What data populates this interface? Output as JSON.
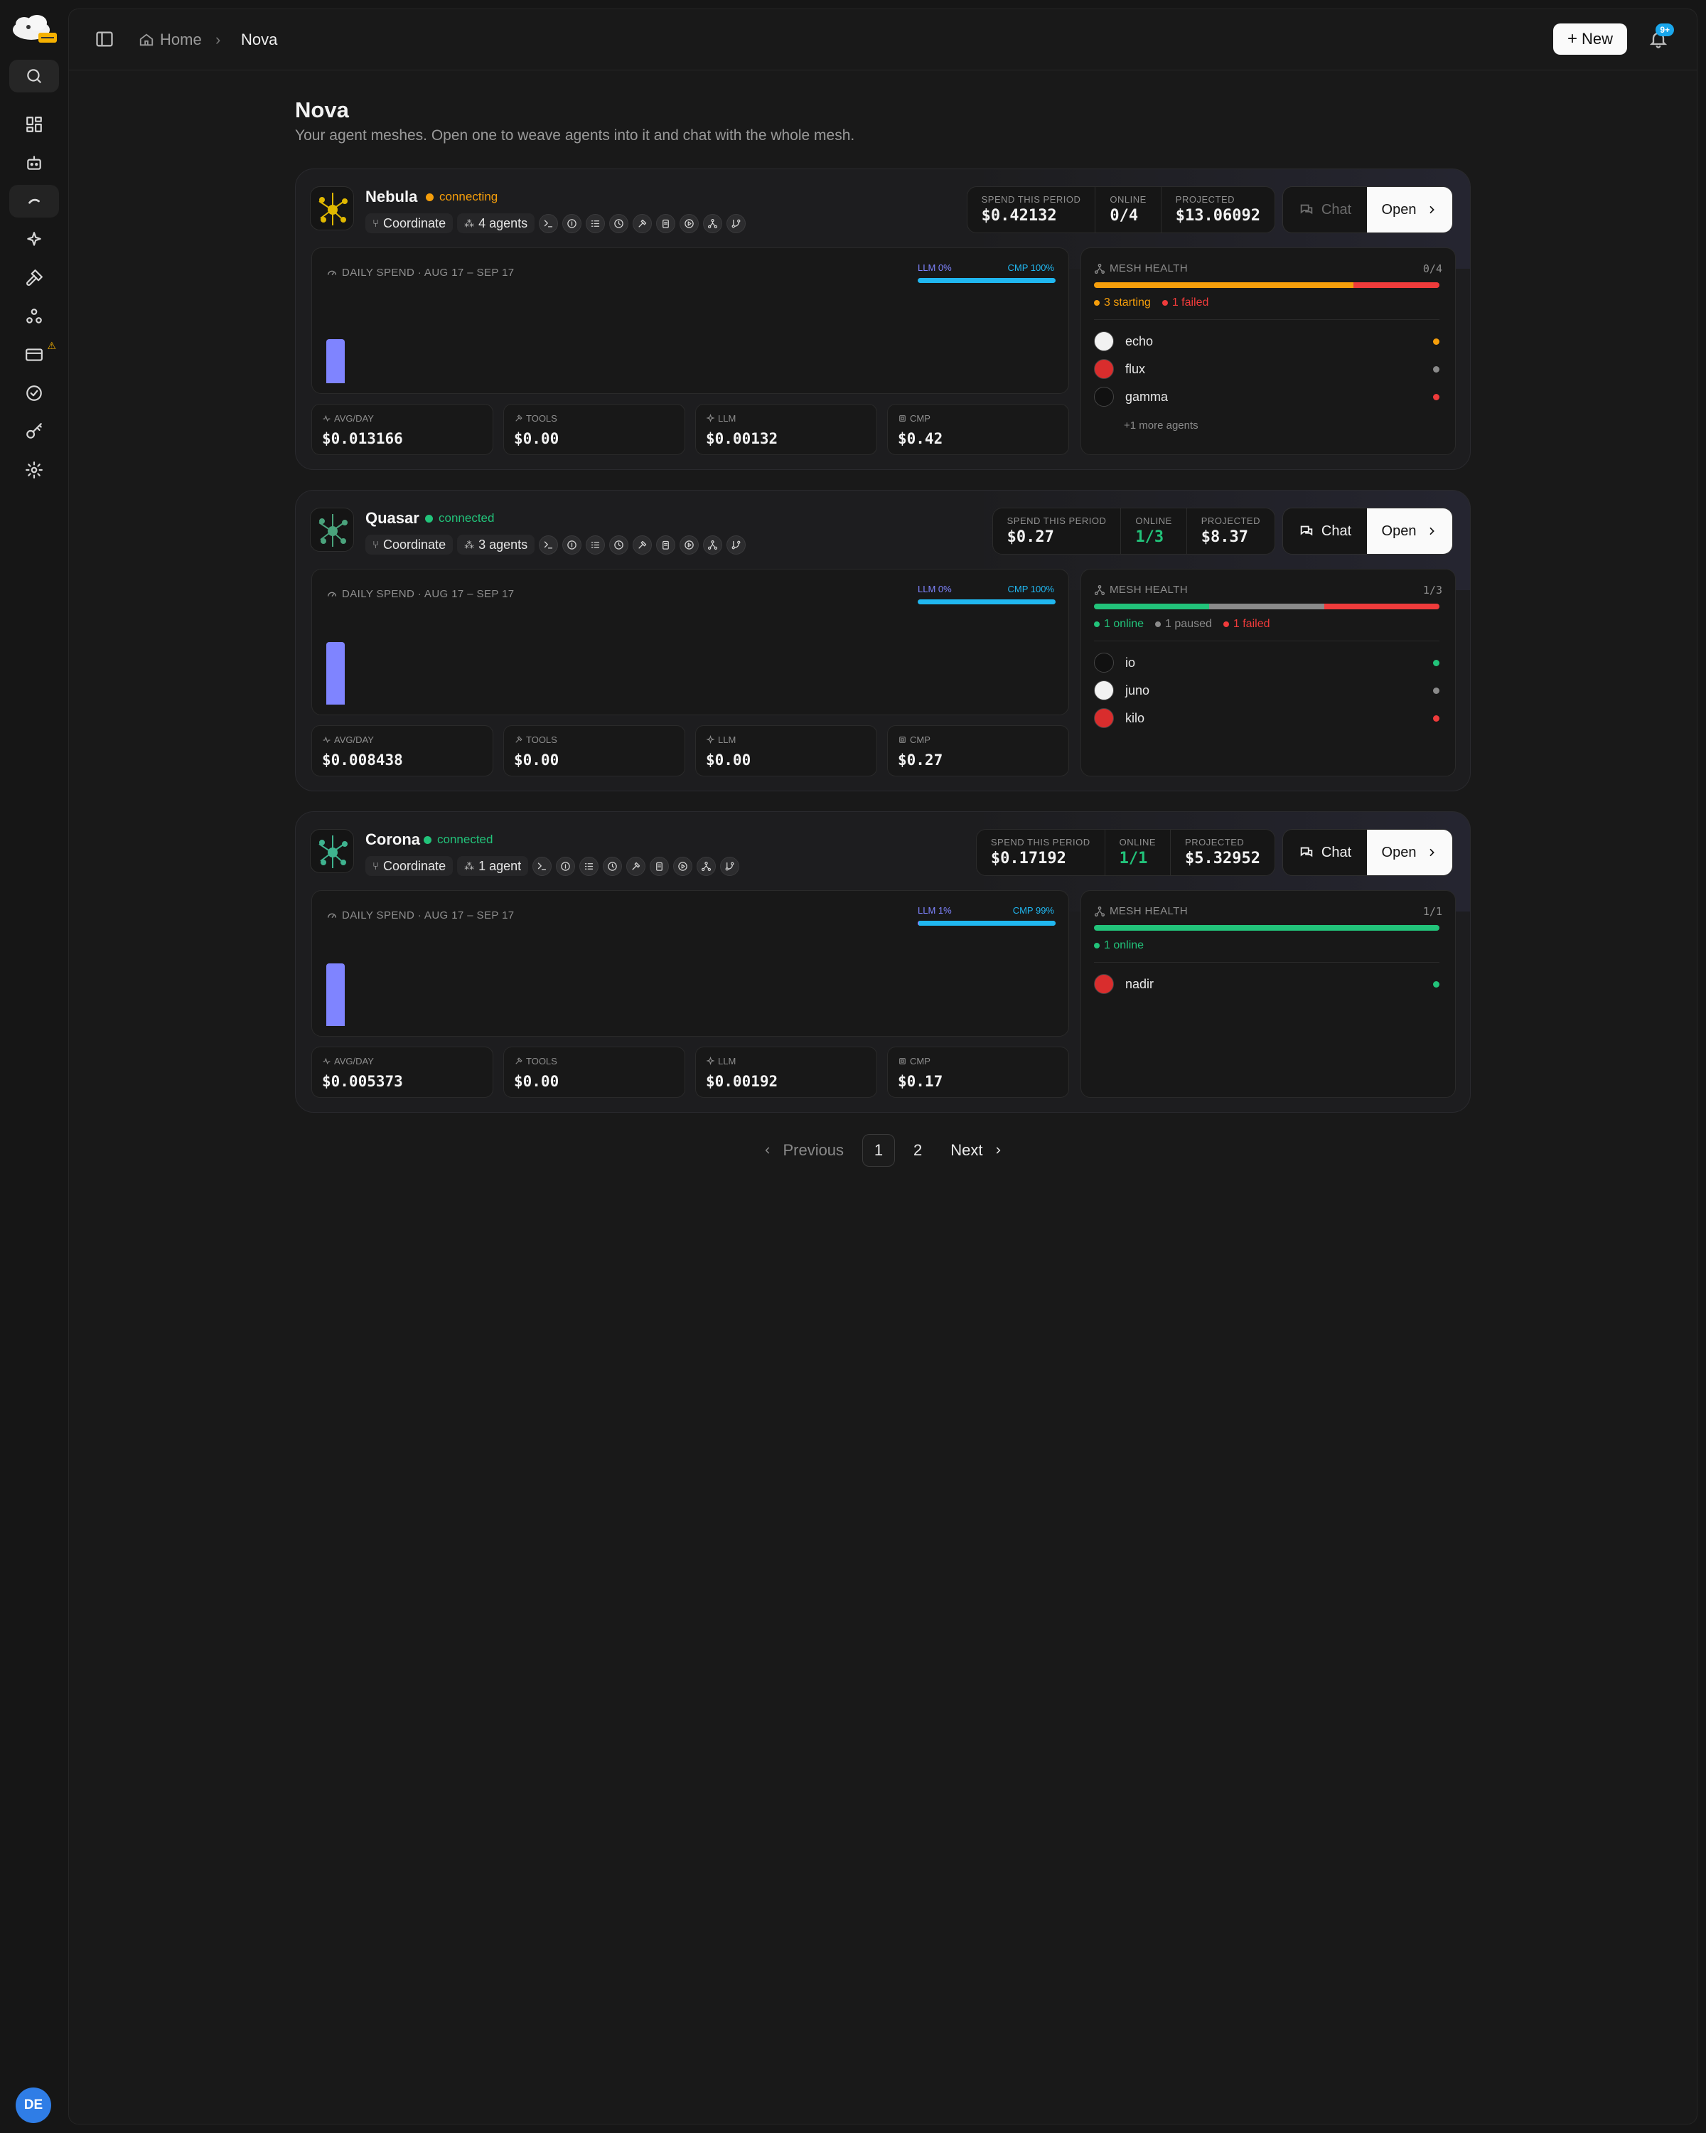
{
  "breadcrumb": {
    "home": "Home",
    "current": "Nova"
  },
  "header": {
    "new_label": "New",
    "notif_badge": "9+"
  },
  "page": {
    "title": "Nova",
    "subtitle": "Your agent meshes. Open one to weave agents into it and chat with the whole mesh."
  },
  "user": {
    "initials": "DE"
  },
  "labels": {
    "spend_this_period": "SPEND THIS PERIOD",
    "online": "ONLINE",
    "projected": "PROJECTED",
    "daily_spend": "DAILY SPEND · AUG 17 – SEP 17",
    "mesh_health": "MESH HEALTH",
    "avg_day": "AVG/DAY",
    "tools": "TOOLS",
    "llm": "LLM",
    "cmp": "CMP",
    "chat": "Chat",
    "open": "Open",
    "coordinate": "Coordinate"
  },
  "colors": {
    "accent_llm": "#7f84ff",
    "accent_cmp": "#20b7f0",
    "online": "#22c37a",
    "starting": "#f59e0b",
    "paused": "#8a8a8a",
    "failed": "#ef3b3b"
  },
  "meshes": [
    {
      "name": "Nebula",
      "status": "connecting",
      "status_color": "#f59e0b",
      "agents_label": "4 agents",
      "spend": "$0.42132",
      "online": "0/4",
      "online_color": "#f2f2f2",
      "projected": "$13.06092",
      "chat_enabled": false,
      "llm_pct": "LLM 0%",
      "cmp_pct": "CMP 100%",
      "llm_share": 0.0,
      "daily_bar_level": 0.48,
      "avg_day": "$0.013166",
      "tools": "$0.00",
      "llm": "$0.00132",
      "cmp": "$0.42",
      "health_count": "0/4",
      "health_segments": [
        {
          "label": "3 starting",
          "count": 3,
          "color": "#f59e0b"
        },
        {
          "label": "1 failed",
          "count": 1,
          "color": "#ef3b3b"
        }
      ],
      "agents": [
        {
          "name": "echo",
          "dot": "#f59e0b"
        },
        {
          "name": "flux",
          "dot": "#8a8a8a"
        },
        {
          "name": "gamma",
          "dot": "#ef3b3b"
        }
      ],
      "more": "+1 more agents"
    },
    {
      "name": "Quasar",
      "status": "connected",
      "status_color": "#22c37a",
      "agents_label": "3 agents",
      "spend": "$0.27",
      "online": "1/3",
      "online_color": "#22c37a",
      "projected": "$8.37",
      "chat_enabled": true,
      "llm_pct": "LLM 0%",
      "cmp_pct": "CMP 100%",
      "llm_share": 0.0,
      "daily_bar_level": 0.68,
      "avg_day": "$0.008438",
      "tools": "$0.00",
      "llm": "$0.00",
      "cmp": "$0.27",
      "health_count": "1/3",
      "health_segments": [
        {
          "label": "1 online",
          "count": 1,
          "color": "#22c37a"
        },
        {
          "label": "1 paused",
          "count": 1,
          "color": "#8a8a8a"
        },
        {
          "label": "1 failed",
          "count": 1,
          "color": "#ef3b3b"
        }
      ],
      "agents": [
        {
          "name": "io",
          "dot": "#22c37a"
        },
        {
          "name": "juno",
          "dot": "#8a8a8a"
        },
        {
          "name": "kilo",
          "dot": "#ef3b3b"
        }
      ],
      "more": ""
    },
    {
      "name": "Corona",
      "status": "connected",
      "status_color": "#22c37a",
      "agents_label": "1 agent",
      "spend": "$0.17192",
      "online": "1/1",
      "online_color": "#22c37a",
      "projected": "$5.32952",
      "chat_enabled": true,
      "llm_pct": "LLM 1%",
      "cmp_pct": "CMP 99%",
      "llm_share": 0.01,
      "daily_bar_level": 0.68,
      "avg_day": "$0.005373",
      "tools": "$0.00",
      "llm": "$0.00192",
      "cmp": "$0.17",
      "health_count": "1/1",
      "health_segments": [
        {
          "label": "1 online",
          "count": 1,
          "color": "#22c37a"
        }
      ],
      "agents": [
        {
          "name": "nadir",
          "dot": "#22c37a"
        }
      ],
      "more": ""
    }
  ],
  "pagination": {
    "previous": "Previous",
    "pages": [
      "1",
      "2"
    ],
    "current": "1",
    "next": "Next"
  }
}
